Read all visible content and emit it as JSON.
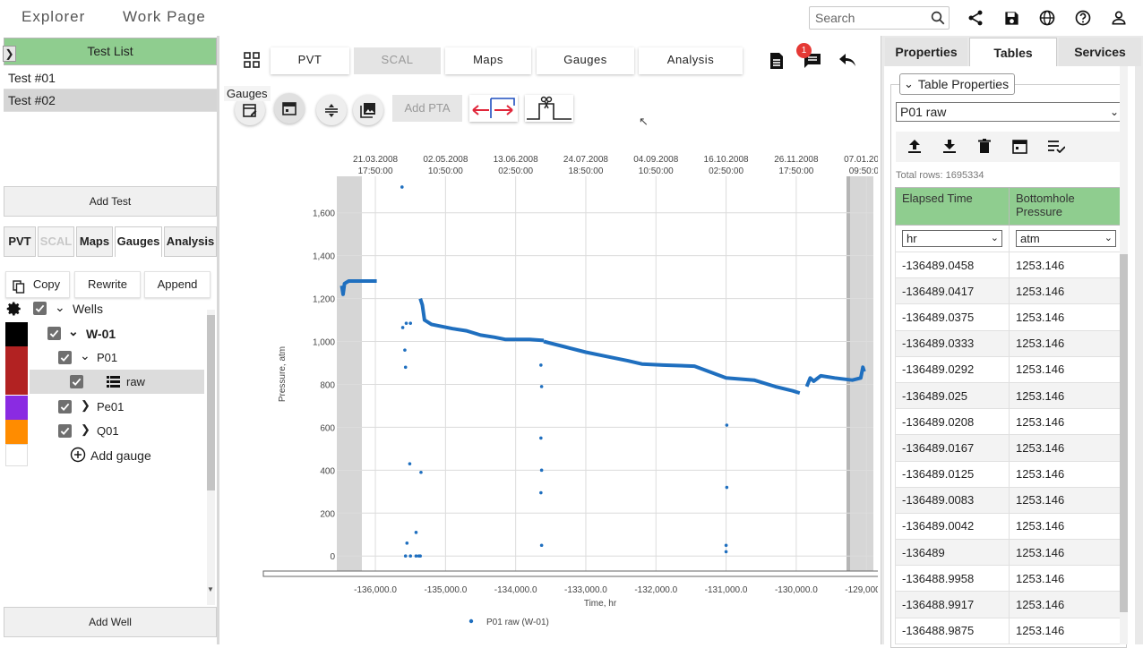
{
  "nav": {
    "explorer": "Explorer",
    "work_page": "Work Page"
  },
  "search": {
    "placeholder": "Search"
  },
  "top_icons": [
    "search-icon",
    "share-icon",
    "save-icon",
    "globe-icon",
    "help-icon",
    "account-icon"
  ],
  "left": {
    "test_list_title": "Test List",
    "tests": [
      "Test #01",
      "Test #02"
    ],
    "add_test": "Add Test",
    "tabs": [
      "PVT",
      "SCAL",
      "Maps",
      "Gauges",
      "Analysis"
    ],
    "actions": {
      "copy": "Copy",
      "rewrite": "Rewrite",
      "append": "Append"
    },
    "tree": {
      "wells": "Wells",
      "well": "W-01",
      "gauge1": "P01",
      "raw": "raw",
      "gauge2": "Pe01",
      "gauge3": "Q01",
      "add_gauge": "Add gauge"
    },
    "swatches": [
      "#000000",
      "#b22222",
      "#b22222",
      "#8a2be2",
      "#ff8c00",
      "#ffffff"
    ],
    "add_well": "Add Well"
  },
  "middle": {
    "tabs": [
      "PVT",
      "SCAL",
      "Maps",
      "Gauges",
      "Analysis"
    ],
    "notification_count": "1",
    "gauges_tooltip": "Gauges",
    "add_pta": "Add PTA"
  },
  "chart_data": {
    "type": "scatter",
    "xlabel": "Time, hr",
    "ylabel": "Pressure, atm",
    "x_ticks": [
      -136000,
      -135000,
      -134000,
      -133000,
      -132000,
      -131000,
      -130000,
      -129000
    ],
    "x_tick_labels": [
      "-136,000.0",
      "-135,000.0",
      "-134,000.0",
      "-133,000.0",
      "-132,000.0",
      "-131,000.0",
      "-130,000.0",
      "-129,000.0"
    ],
    "y_ticks": [
      0,
      200,
      400,
      600,
      800,
      1000,
      1200,
      1400,
      1600
    ],
    "y_tick_labels": [
      "0",
      "200",
      "400",
      "600",
      "800",
      "1,000",
      "1,200",
      "1,400",
      "1,600"
    ],
    "top_date_labels": [
      [
        "21.03.2008",
        "17:50:00"
      ],
      [
        "02.05.2008",
        "10:50:00"
      ],
      [
        "13.06.2008",
        "02:50:00"
      ],
      [
        "24.07.2008",
        "18:50:00"
      ],
      [
        "04.09.2008",
        "10:50:00"
      ],
      [
        "16.10.2008",
        "02:50:00"
      ],
      [
        "26.11.2008",
        "17:50:00"
      ],
      [
        "07.01.2009",
        "09:50:00"
      ]
    ],
    "xlim": [
      -136550,
      -128900
    ],
    "ylim": [
      -70,
      1770
    ],
    "series": [
      {
        "name": "P01 raw (W-01)",
        "color": "#1f6fbf",
        "lines": [
          [
            [
              -136480,
              1260
            ],
            [
              -136460,
              1220
            ],
            [
              -136440,
              1270
            ],
            [
              -136380,
              1282
            ],
            [
              -135980,
              1282
            ]
          ],
          [
            [
              -135360,
              1200
            ],
            [
              -135330,
              1170
            ],
            [
              -135300,
              1100
            ],
            [
              -135200,
              1080
            ],
            [
              -134900,
              1060
            ],
            [
              -134700,
              1050
            ],
            [
              -134500,
              1030
            ],
            [
              -134300,
              1020
            ],
            [
              -134150,
              1010
            ],
            [
              -133800,
              1010
            ],
            [
              -133600,
              1005
            ]
          ],
          [
            [
              -133600,
              1000
            ],
            [
              -133300,
              975
            ],
            [
              -133000,
              950
            ],
            [
              -132700,
              930
            ],
            [
              -132400,
              910
            ],
            [
              -132200,
              895
            ],
            [
              -131900,
              890
            ],
            [
              -131450,
              885
            ],
            [
              -131000,
              830
            ],
            [
              -130600,
              820
            ],
            [
              -130300,
              790
            ],
            [
              -130050,
              770
            ],
            [
              -129950,
              760
            ]
          ],
          [
            [
              -129850,
              790
            ],
            [
              -129800,
              830
            ],
            [
              -129750,
              815
            ],
            [
              -129650,
              840
            ],
            [
              -129450,
              830
            ],
            [
              -129200,
              820
            ],
            [
              -129080,
              830
            ],
            [
              -129050,
              880
            ],
            [
              -129030,
              860
            ]
          ]
        ],
        "points": [
          [
            -135620,
            1720
          ],
          [
            -135610,
            1065
          ],
          [
            -135560,
            1085
          ],
          [
            -135500,
            1085
          ],
          [
            -135580,
            960
          ],
          [
            -135570,
            880
          ],
          [
            -135510,
            430
          ],
          [
            -135350,
            390
          ],
          [
            -135420,
            110
          ],
          [
            -135550,
            60
          ],
          [
            -135570,
            0
          ],
          [
            -135500,
            0
          ],
          [
            -135420,
            0
          ],
          [
            -135380,
            0
          ],
          [
            -135360,
            0
          ],
          [
            -133640,
            890
          ],
          [
            -133630,
            790
          ],
          [
            -133640,
            550
          ],
          [
            -133630,
            400
          ],
          [
            -133640,
            295
          ],
          [
            -133630,
            50
          ],
          [
            -130990,
            610
          ],
          [
            -130990,
            320
          ],
          [
            -131000,
            50
          ],
          [
            -131000,
            20
          ]
        ]
      }
    ],
    "grid": true,
    "legend": "bottom-center"
  },
  "right": {
    "tabs": [
      "Properties",
      "Tables",
      "Services"
    ],
    "legend_title": "Table Properties",
    "selected_table": "P01 raw",
    "total_rows": "Total rows: 1695334",
    "columns": [
      "Elapsed Time",
      "Bottomhole Pressure"
    ],
    "units": [
      "hr",
      "atm"
    ],
    "rows": [
      [
        "-136489.0458",
        "1253.146"
      ],
      [
        "-136489.0417",
        "1253.146"
      ],
      [
        "-136489.0375",
        "1253.146"
      ],
      [
        "-136489.0333",
        "1253.146"
      ],
      [
        "-136489.0292",
        "1253.146"
      ],
      [
        "-136489.025",
        "1253.146"
      ],
      [
        "-136489.0208",
        "1253.146"
      ],
      [
        "-136489.0167",
        "1253.146"
      ],
      [
        "-136489.0125",
        "1253.146"
      ],
      [
        "-136489.0083",
        "1253.146"
      ],
      [
        "-136489.0042",
        "1253.146"
      ],
      [
        "-136489",
        "1253.146"
      ],
      [
        "-136488.9958",
        "1253.146"
      ],
      [
        "-136488.9917",
        "1253.146"
      ],
      [
        "-136488.9875",
        "1253.146"
      ]
    ]
  }
}
